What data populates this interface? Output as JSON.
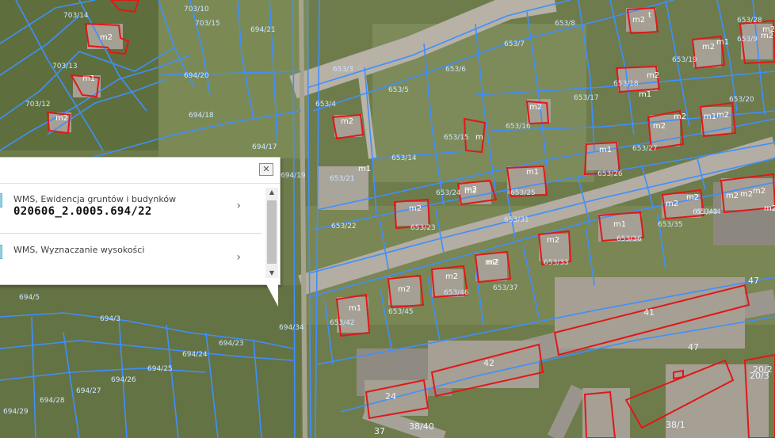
{
  "popup": {
    "close_symbol": "✕",
    "rows": [
      {
        "layer": "WMS, Ewidencja gruntów i budynków",
        "value": "020606_2.0005.694/22",
        "chevron": "›"
      },
      {
        "layer": "WMS, Wyznaczanie wysokości",
        "value": "",
        "chevron": "›"
      }
    ],
    "scroll_up": "▲",
    "scroll_down": "▼"
  },
  "parcel_labels": [
    "703/14",
    "703/10",
    "703/15",
    "703/13",
    "703/12",
    "694/21",
    "694/20",
    "694/18",
    "694/17",
    "694/19",
    "653/3",
    "653/4",
    "653/5",
    "653/6",
    "653/7",
    "653/8",
    "653/9",
    "653/20",
    "653/21",
    "653/14",
    "653/16",
    "653/17",
    "653/18",
    "653/19",
    "653/22",
    "653/23",
    "653/24",
    "653/25",
    "653/26",
    "653/27",
    "653/28",
    "653/31",
    "653/33",
    "653/35",
    "653/36",
    "653/37",
    "653/42",
    "653/43",
    "653/44",
    "653/45",
    "653/46",
    "694/3",
    "694/5",
    "694/23",
    "694/24",
    "694/25",
    "694/26",
    "694/27",
    "694/28",
    "694/29",
    "694/34",
    "653/15"
  ],
  "building_labels": [
    "m2",
    "m1",
    "m2",
    "m2",
    "m1",
    "m2",
    "m2",
    "m",
    "m2",
    "m2",
    "m2",
    "m1",
    "m1",
    "m2",
    "m1",
    "m2",
    "m2",
    "m2",
    "m1",
    "m2",
    "m2",
    "m2",
    "m2",
    "m2",
    "m2",
    "m2",
    "m2",
    "m1",
    "m2",
    "m2",
    "m2",
    "m1",
    "m2",
    "m2",
    "m1",
    "m2",
    "t"
  ],
  "street_labels": [
    "47",
    "47",
    "42",
    "41",
    "24",
    "37",
    "38/40",
    "38/1",
    "20/3",
    "20/2"
  ],
  "colors": {
    "parcel_line": "#3f8fff",
    "building_outline": "#e01818",
    "vegetation": "#6b7d47",
    "roof": "#a9a39b"
  }
}
